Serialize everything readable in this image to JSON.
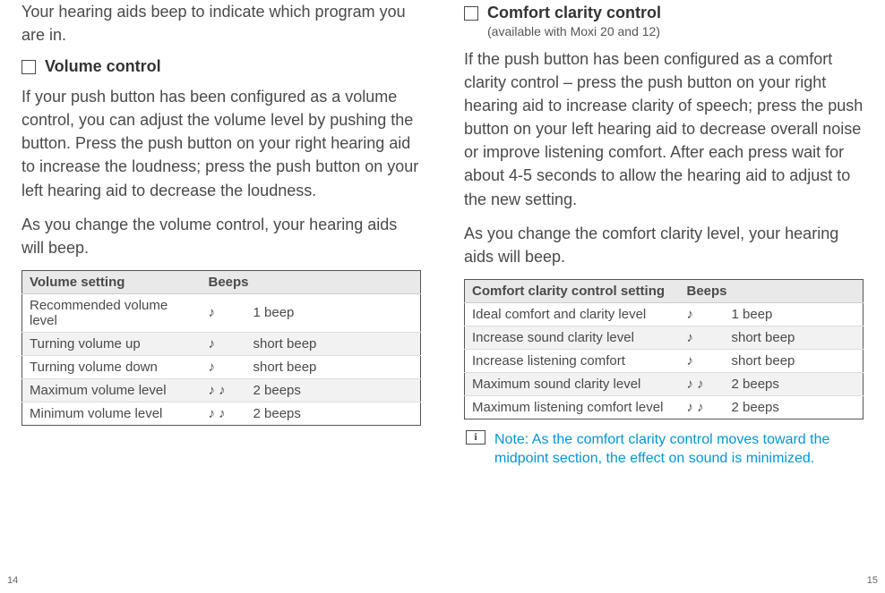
{
  "left": {
    "intro": "Your hearing aids beep to indicate which program you are in.",
    "heading": "Volume control",
    "para1": "If your push button has been configured as a volume control, you can adjust the volume level by pushing the button. Press the push button on your right hearing aid to increase the loudness; press the push button on your left hearing aid to decrease the loudness.",
    "para2": "As you change the volume control, your hearing aids will beep.",
    "table": {
      "h1": "Volume setting",
      "h2": "Beeps",
      "rows": [
        {
          "setting": "Recommended volume level",
          "icon": "♪",
          "beeps": "1 beep"
        },
        {
          "setting": "Turning volume up",
          "icon": "♪",
          "beeps": "short beep"
        },
        {
          "setting": "Turning volume down",
          "icon": "♪",
          "beeps": "short beep"
        },
        {
          "setting": "Maximum volume level",
          "icon": "♪ ♪",
          "beeps": "2 beeps"
        },
        {
          "setting": "Minimum volume level",
          "icon": "♪ ♪",
          "beeps": "2 beeps"
        }
      ]
    },
    "pageNumber": "14"
  },
  "right": {
    "heading": "Comfort clarity control",
    "sub": "(available with Moxi 20 and 12)",
    "para1": "If the push button has been configured as a comfort clarity control – press the push button on your right hearing aid to increase clarity of speech; press the push button on your left hearing aid to decrease overall noise or improve listening comfort. After each press wait for about 4-5 seconds to allow the hearing aid to adjust to the new setting.",
    "para2": "As you change the comfort clarity level, your hearing aids will beep.",
    "table": {
      "h1": "Comfort clarity control setting",
      "h2": "Beeps",
      "rows": [
        {
          "setting": "Ideal comfort and clarity level",
          "icon": "♪",
          "beeps": "1 beep"
        },
        {
          "setting": "Increase sound clarity level",
          "icon": "♪",
          "beeps": "short beep"
        },
        {
          "setting": "Increase listening comfort",
          "icon": "♪",
          "beeps": "short beep"
        },
        {
          "setting": "Maximum sound clarity level",
          "icon": "♪ ♪",
          "beeps": "2 beeps"
        },
        {
          "setting": "Maximum listening comfort level",
          "icon": "♪ ♪",
          "beeps": "2 beeps"
        }
      ]
    },
    "infoSymbol": "i",
    "note": "Note: As the comfort clarity control moves toward the midpoint section, the effect on sound is minimized.",
    "pageNumber": "15"
  }
}
